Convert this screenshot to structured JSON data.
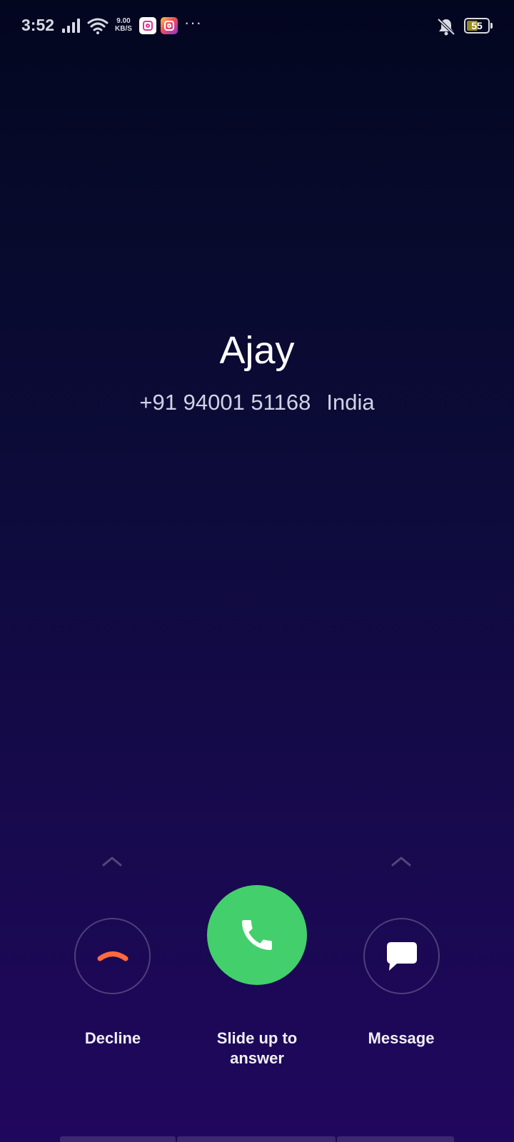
{
  "status_bar": {
    "time": "3:52",
    "net_speed_value": "9.00",
    "net_speed_unit": "KB/S",
    "battery_level": "55",
    "battery_fraction": 0.55,
    "more_glyph": "···",
    "icons": {
      "signal": "signal-strength-icon",
      "wifi": "wifi-icon",
      "notifications": [
        "instagram-icon",
        "instagram-icon"
      ],
      "vibrate": "vibrate-icon",
      "battery": "battery-icon"
    }
  },
  "caller": {
    "name": "Ajay",
    "number": "+91 94001 51168",
    "country": "India"
  },
  "actions": {
    "decline_label": "Decline",
    "answer_label": "Slide up to answer",
    "message_label": "Message",
    "icons": {
      "decline": "phone-hangup-icon",
      "answer": "phone-icon",
      "message": "chat-bubble-icon",
      "swipe_hint": "chevron-up-icon"
    }
  },
  "colors": {
    "background_top": "#03061f",
    "background_bottom": "#20075e",
    "answer": "#43cf6b",
    "decline": "#ff6a3d",
    "battery_fill": "#9a8c1f"
  }
}
